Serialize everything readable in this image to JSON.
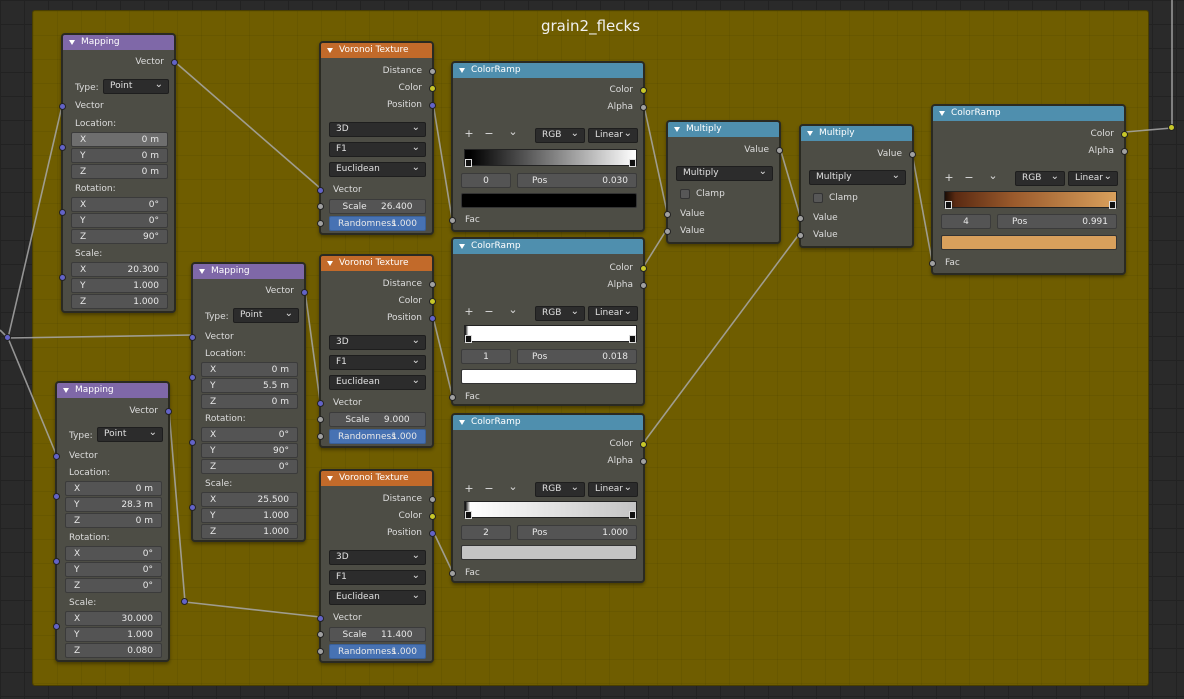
{
  "frame": {
    "title": "grain2_flecks"
  },
  "mappings": [
    {
      "title": "Mapping",
      "output": "Vector",
      "type_label": "Type:",
      "type": "Point",
      "input": "Vector",
      "location_label": "Location:",
      "rotation_label": "Rotation:",
      "scale_label": "Scale:",
      "location": [
        {
          "k": "X",
          "v": "0 m"
        },
        {
          "k": "Y",
          "v": "0 m"
        },
        {
          "k": "Z",
          "v": "0 m"
        }
      ],
      "rotation": [
        {
          "k": "X",
          "v": "0°"
        },
        {
          "k": "Y",
          "v": "0°"
        },
        {
          "k": "Z",
          "v": "90°"
        }
      ],
      "scale": [
        {
          "k": "X",
          "v": "20.300"
        },
        {
          "k": "Y",
          "v": "1.000"
        },
        {
          "k": "Z",
          "v": "1.000"
        }
      ]
    },
    {
      "title": "Mapping",
      "output": "Vector",
      "type_label": "Type:",
      "type": "Point",
      "input": "Vector",
      "location_label": "Location:",
      "rotation_label": "Rotation:",
      "scale_label": "Scale:",
      "location": [
        {
          "k": "X",
          "v": "0 m"
        },
        {
          "k": "Y",
          "v": "5.5 m"
        },
        {
          "k": "Z",
          "v": "0 m"
        }
      ],
      "rotation": [
        {
          "k": "X",
          "v": "0°"
        },
        {
          "k": "Y",
          "v": "90°"
        },
        {
          "k": "Z",
          "v": "0°"
        }
      ],
      "scale": [
        {
          "k": "X",
          "v": "25.500"
        },
        {
          "k": "Y",
          "v": "1.000"
        },
        {
          "k": "Z",
          "v": "1.000"
        }
      ]
    },
    {
      "title": "Mapping",
      "output": "Vector",
      "type_label": "Type:",
      "type": "Point",
      "input": "Vector",
      "location_label": "Location:",
      "rotation_label": "Rotation:",
      "scale_label": "Scale:",
      "location": [
        {
          "k": "X",
          "v": "0 m"
        },
        {
          "k": "Y",
          "v": "28.3 m"
        },
        {
          "k": "Z",
          "v": "0 m"
        }
      ],
      "rotation": [
        {
          "k": "X",
          "v": "0°"
        },
        {
          "k": "Y",
          "v": "0°"
        },
        {
          "k": "Z",
          "v": "0°"
        }
      ],
      "scale": [
        {
          "k": "X",
          "v": "30.000"
        },
        {
          "k": "Y",
          "v": "1.000"
        },
        {
          "k": "Z",
          "v": "0.080"
        }
      ]
    }
  ],
  "voronois": [
    {
      "title": "Voronoi Texture",
      "out_distance": "Distance",
      "out_color": "Color",
      "out_position": "Position",
      "dim": "3D",
      "feature": "F1",
      "metric": "Euclidean",
      "in_vector": "Vector",
      "scale_label": "Scale",
      "scale": "26.400",
      "rand_label": "Randomness",
      "randomness": "1.000"
    },
    {
      "title": "Voronoi Texture",
      "out_distance": "Distance",
      "out_color": "Color",
      "out_position": "Position",
      "dim": "3D",
      "feature": "F1",
      "metric": "Euclidean",
      "in_vector": "Vector",
      "scale_label": "Scale",
      "scale": "9.000",
      "rand_label": "Randomness",
      "randomness": "1.000"
    },
    {
      "title": "Voronoi Texture",
      "out_distance": "Distance",
      "out_color": "Color",
      "out_position": "Position",
      "dim": "3D",
      "feature": "F1",
      "metric": "Euclidean",
      "in_vector": "Vector",
      "scale_label": "Scale",
      "scale": "11.400",
      "rand_label": "Randomness",
      "randomness": "1.000"
    }
  ],
  "ramps": [
    {
      "title": "ColorRamp",
      "out_color": "Color",
      "out_alpha": "Alpha",
      "mode": "RGB",
      "interp": "Linear",
      "index": "0",
      "pos_label": "Pos",
      "pos": "0.030",
      "in_fac": "Fac",
      "swatch": "#000000",
      "grad": "linear-gradient(90deg,#000 0%,#000 3%,#fff 100%)"
    },
    {
      "title": "ColorRamp",
      "out_color": "Color",
      "out_alpha": "Alpha",
      "mode": "RGB",
      "interp": "Linear",
      "index": "1",
      "pos_label": "Pos",
      "pos": "0.018",
      "in_fac": "Fac",
      "swatch": "#ffffff",
      "grad": "linear-gradient(90deg,#000 0%,#fff 2%,#fff 100%)"
    },
    {
      "title": "ColorRamp",
      "out_color": "Color",
      "out_alpha": "Alpha",
      "mode": "RGB",
      "interp": "Linear",
      "index": "2",
      "pos_label": "Pos",
      "pos": "1.000",
      "in_fac": "Fac",
      "swatch": "#c4c4c4",
      "grad": "linear-gradient(90deg,#000 0%,#fff 3%,#c4c4c4 100%)"
    },
    {
      "title": "ColorRamp",
      "out_color": "Color",
      "out_alpha": "Alpha",
      "mode": "RGB",
      "interp": "Linear",
      "index": "4",
      "pos_label": "Pos",
      "pos": "0.991",
      "in_fac": "Fac",
      "swatch": "#d9a05c",
      "grad": "linear-gradient(90deg,#1a0d05 0%,#5a2a12 6%,#9a5a2c 40%,#d9a05c 100%)"
    }
  ],
  "multiplies": [
    {
      "title": "Multiply",
      "out": "Value",
      "op": "Multiply",
      "clamp": "Clamp",
      "in1": "Value",
      "in2": "Value"
    },
    {
      "title": "Multiply",
      "out": "Value",
      "op": "Multiply",
      "clamp": "Clamp",
      "in1": "Value",
      "in2": "Value"
    }
  ],
  "controls": {
    "plus": "+",
    "minus": "−",
    "chevron": "⌄"
  }
}
